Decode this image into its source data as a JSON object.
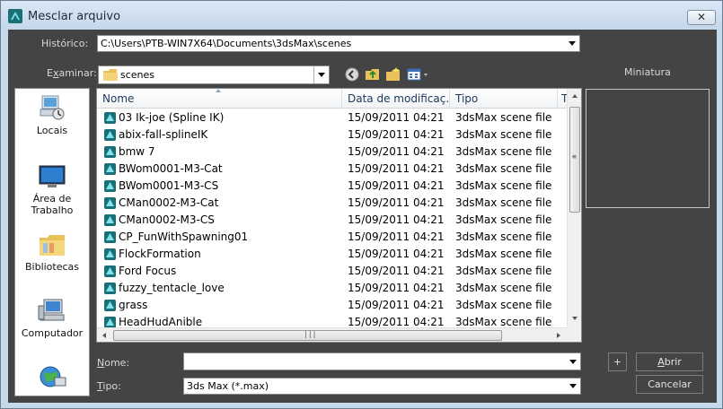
{
  "window": {
    "title": "Mesclar arquivo",
    "close_glyph": "✕"
  },
  "history": {
    "label": "Histórico:",
    "value": "C:\\Users\\PTB-WIN7X64\\Documents\\3dsMax\\scenes"
  },
  "lookin": {
    "label_prefix": "E",
    "label_underlined": "x",
    "label_rest": "aminar:",
    "value": "scenes",
    "toolbar_icons": [
      "back-icon",
      "up-folder-icon",
      "new-folder-icon",
      "view-menu-icon"
    ]
  },
  "thumbnail": {
    "label": "Miniatura"
  },
  "places": [
    {
      "label": "Locais",
      "icon": "recent-places-icon"
    },
    {
      "label": "Área de Trabalho",
      "icon": "desktop-icon"
    },
    {
      "label": "Bibliotecas",
      "icon": "libraries-icon"
    },
    {
      "label": "Computador",
      "icon": "computer-icon"
    },
    {
      "label": "",
      "icon": "network-icon"
    }
  ],
  "file_list": {
    "columns": [
      "Nome",
      "Data de modificaç...",
      "Tipo",
      "T"
    ],
    "rows": [
      {
        "name": "03 Ik-joe (Spline IK)",
        "date": "15/09/2011 04:21",
        "type": "3dsMax scene file"
      },
      {
        "name": "abix-fall-splineIK",
        "date": "15/09/2011 04:21",
        "type": "3dsMax scene file"
      },
      {
        "name": "bmw 7",
        "date": "15/09/2011 04:21",
        "type": "3dsMax scene file"
      },
      {
        "name": "BWom0001-M3-Cat",
        "date": "15/09/2011 04:21",
        "type": "3dsMax scene file"
      },
      {
        "name": "BWom0001-M3-CS",
        "date": "15/09/2011 04:21",
        "type": "3dsMax scene file"
      },
      {
        "name": "CMan0002-M3-Cat",
        "date": "15/09/2011 04:21",
        "type": "3dsMax scene file"
      },
      {
        "name": "CMan0002-M3-CS",
        "date": "15/09/2011 04:21",
        "type": "3dsMax scene file"
      },
      {
        "name": "CP_FunWithSpawning01",
        "date": "15/09/2011 04:21",
        "type": "3dsMax scene file"
      },
      {
        "name": "FlockFormation",
        "date": "15/09/2011 04:21",
        "type": "3dsMax scene file"
      },
      {
        "name": "Ford Focus",
        "date": "15/09/2011 04:21",
        "type": "3dsMax scene file"
      },
      {
        "name": "fuzzy_tentacle_love",
        "date": "15/09/2011 04:21",
        "type": "3dsMax scene file"
      },
      {
        "name": "grass",
        "date": "15/09/2011 04:21",
        "type": "3dsMax scene file"
      },
      {
        "name": "HeadHudAnible",
        "date": "15/09/2011 04:21",
        "type": "3dsMax scene file"
      }
    ]
  },
  "filename": {
    "label_underlined": "N",
    "label_rest": "ome:",
    "value": ""
  },
  "filetype": {
    "label_underlined": "T",
    "label_rest": "ipo:",
    "value": "3ds Max (*.max)"
  },
  "buttons": {
    "plus": "+",
    "open_underlined": "A",
    "open_rest": "brir",
    "cancel": "Cancelar"
  }
}
